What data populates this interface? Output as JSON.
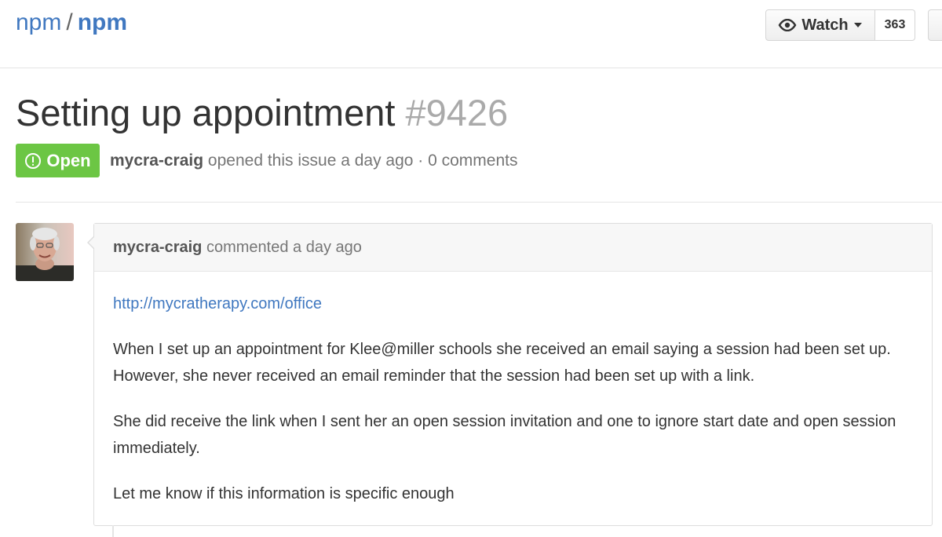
{
  "repo": {
    "owner": "npm",
    "separator": "/",
    "name": "npm"
  },
  "watch": {
    "label": "Watch",
    "count": "363",
    "icon": "eye-icon"
  },
  "issue": {
    "title": "Setting up appointment",
    "number": "#9426",
    "state": "Open",
    "state_icon": "issue-opened-icon",
    "state_color": "#6cc644",
    "author": "mycra-craig",
    "opened_text": "opened this issue a day ago · 0 comments"
  },
  "comment": {
    "author": "mycra-craig",
    "action": "commented a day ago",
    "link": "http://mycratherapy.com/office",
    "paragraphs": [
      "When I set up an appointment for Klee@miller schools she received an email saying a session had been set up. However, she never received an email reminder that the session had been set up with a link.",
      "She did receive the link when I sent her an open session invitation and one to ignore start date and open session immediately.",
      "Let me know if this information is specific enough"
    ]
  },
  "colors": {
    "link": "#4078c0",
    "muted": "#767676"
  }
}
